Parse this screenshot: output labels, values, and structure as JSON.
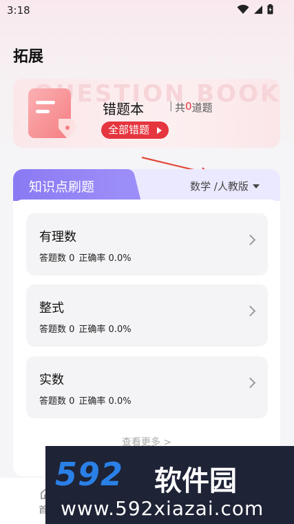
{
  "status_bar": {
    "time": "3:18"
  },
  "page": {
    "title": "拓展"
  },
  "mistake_book": {
    "watermark": "QUESTION BOOK",
    "title": "错题本",
    "separator": "|",
    "total_prefix": "共",
    "total_count": "0",
    "total_suffix": "道题",
    "button_label": "全部错题"
  },
  "knowledge": {
    "tab_label": "知识点刷题",
    "subject": "数学 /人教版",
    "topics": [
      {
        "name": "有理数",
        "answered_label": "答题数 0",
        "accuracy_label": "正确率 0.0%"
      },
      {
        "name": "整式",
        "answered_label": "答题数 0",
        "accuracy_label": "正确率 0.0%"
      },
      {
        "name": "实数",
        "answered_label": "答题数 0",
        "accuracy_label": "正确率 0.0%"
      }
    ],
    "view_more": "查看更多 >"
  },
  "bottom_nav": {
    "home_label": "首"
  },
  "overlay_watermark": {
    "logo": "592",
    "name": "软件园",
    "url": "www.592xiazai.com"
  },
  "colors": {
    "accent_red": "#e5353e",
    "tab_purple": "#8a7af3",
    "watermark_blue": "#2a80e6"
  }
}
